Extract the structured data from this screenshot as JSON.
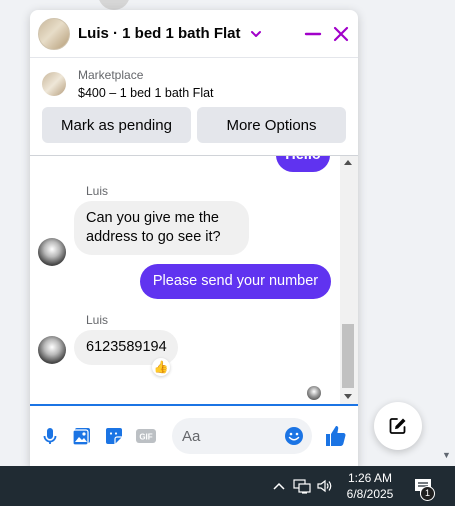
{
  "chat": {
    "title": "Luis · 1 bed 1 bath Flat",
    "listing": {
      "label": "Marketplace",
      "title": "$400 – 1 bed 1 bath Flat"
    },
    "actions": {
      "mark_pending": "Mark as pending",
      "more_options": "More Options"
    },
    "messages": {
      "partial_out": "Hello",
      "sender_1": "Luis",
      "in_1_line1": "Can you give me the",
      "in_1_line2": "address to go see it?",
      "out_1": "Please send your number",
      "sender_2": "Luis",
      "in_2": "6123589194",
      "reaction": "👍"
    },
    "composer": {
      "placeholder": "Aa"
    }
  },
  "taskbar": {
    "time": "1:26 AM",
    "date": "6/8/2025",
    "notification_count": "1"
  },
  "colors": {
    "accent": "#a100c9",
    "bubble_out": "#6033f0",
    "bubble_in": "#f0f0f0",
    "composer_icons": "#1b74e4"
  }
}
